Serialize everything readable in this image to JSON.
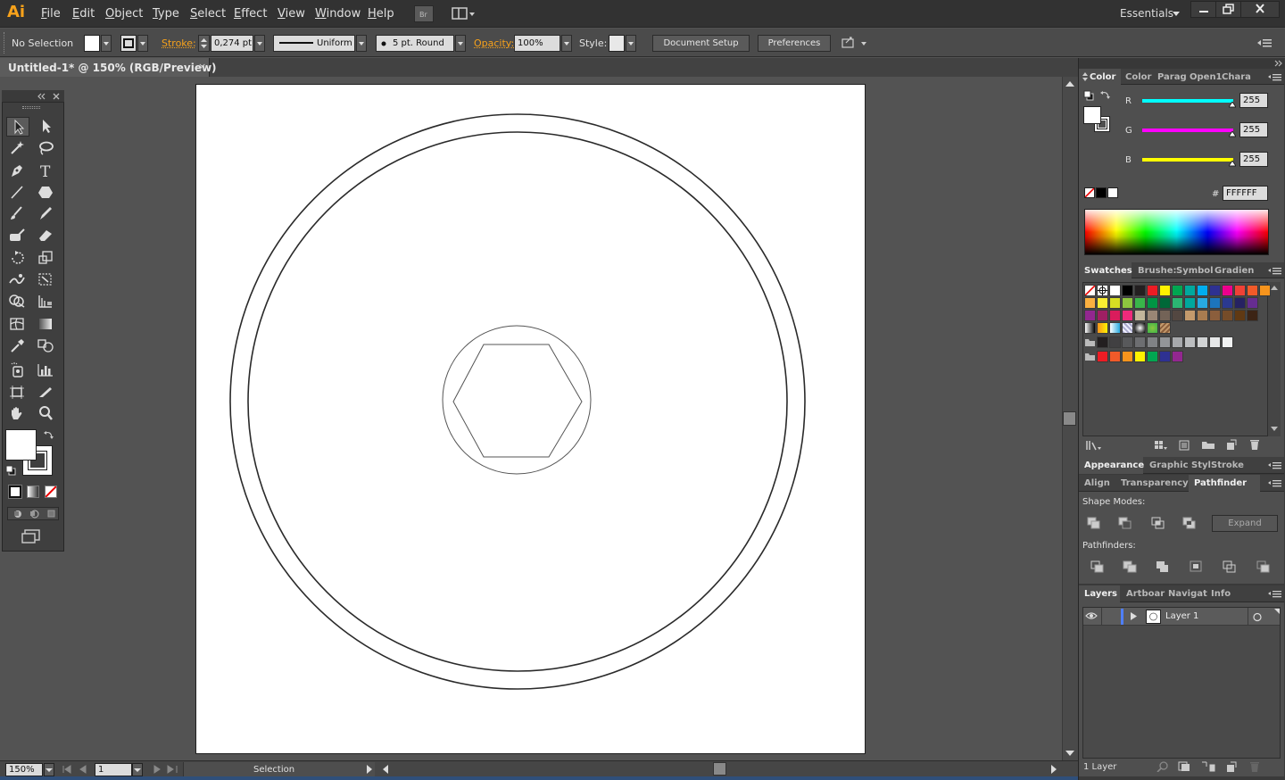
{
  "app": {
    "logo": "Ai"
  },
  "menu": [
    "File",
    "Edit",
    "Object",
    "Type",
    "Select",
    "Effect",
    "View",
    "Window",
    "Help"
  ],
  "workspace": {
    "label": "Essentials"
  },
  "control": {
    "selection": "No Selection",
    "stroke_label": "Stroke:",
    "stroke_weight": "0,274 pt",
    "profile": "Uniform",
    "brush": "5 pt. Round",
    "opacity_label": "Opacity:",
    "opacity": "100%",
    "style_label": "Style:",
    "document_setup": "Document Setup",
    "preferences": "Preferences"
  },
  "document": {
    "tab_title": "Untitled-1* @ 150% (RGB/Preview)",
    "close": "×"
  },
  "status": {
    "zoom": "150%",
    "artboard": "1",
    "tool": "Selection"
  },
  "color_panel": {
    "tabs": [
      "Color",
      "Color",
      "Parag",
      "Open1",
      "Chara"
    ],
    "r_label": "R",
    "g_label": "G",
    "b_label": "B",
    "r": "255",
    "g": "255",
    "b": "255",
    "hash": "#",
    "hex": "FFFFFF"
  },
  "swatches_panel": {
    "tabs": [
      "Swatches",
      "Brushe:",
      "Symbol",
      "Gradien"
    ]
  },
  "appearance_panel": {
    "tabs": [
      "Appearance",
      "Graphic Styl",
      "Stroke"
    ]
  },
  "pathfinder_panel": {
    "tabs": [
      "Align",
      "Transparency",
      "Pathfinder"
    ],
    "shape_modes": "Shape Modes:",
    "expand": "Expand",
    "pathfinders": "Pathfinders:"
  },
  "layers_panel": {
    "tabs": [
      "Layers",
      "Artboar",
      "Navigat",
      "Info"
    ],
    "layer_name": "Layer 1",
    "count": "1 Layer"
  },
  "colors": {
    "swatch_row1": [
      "#ffffff",
      "#000000",
      "#231f20",
      "#ed1c24",
      "#fff200",
      "#00a651",
      "#00a99d",
      "#00aeef",
      "#2e3192",
      "#ec008c",
      "#ef4136",
      "#f15a29",
      "#f7941d"
    ],
    "swatch_row2": [
      "#fbb040",
      "#f9ed32",
      "#d7df23",
      "#8dc63f",
      "#39b54a",
      "#009444",
      "#006838",
      "#2bb673",
      "#00a79d",
      "#27aae1",
      "#1c75bc",
      "#2b3990",
      "#262262",
      "#662d91"
    ],
    "swatch_row3": [
      "#92278f",
      "#9e1f63",
      "#da1c5c",
      "#ee2a7b",
      "#c2b59b",
      "#998675",
      "#736357",
      "#534741",
      "#c49a6c",
      "#a97c50",
      "#8b5e3c",
      "#754c29",
      "#603913",
      "#3c2415"
    ],
    "swatch_row5": [
      "#231f20",
      "#414042",
      "#58595b",
      "#6d6e71",
      "#808285",
      "#939598",
      "#a7a9ac",
      "#bcbec0",
      "#d1d3d4",
      "#e6e7e8",
      "#f1f2f2"
    ],
    "swatch_row6": [
      "#ed1c24",
      "#f15a29",
      "#f7941d",
      "#fff200",
      "#00a651",
      "#2e3192",
      "#92278f"
    ]
  }
}
